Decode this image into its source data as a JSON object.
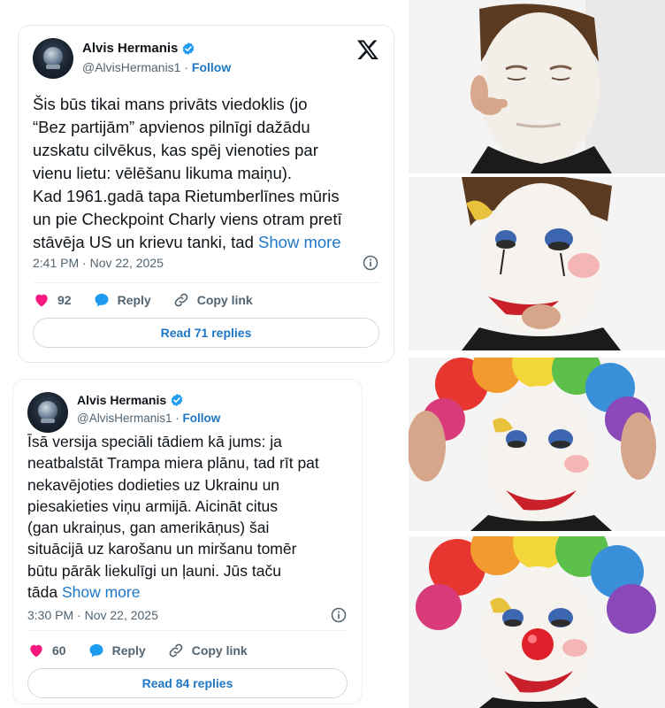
{
  "tweets": [
    {
      "author": "Alvis Hermanis",
      "handle": "@AlvisHermanis1",
      "separator": "·",
      "follow_label": "Follow",
      "text": "Šis būs tikai mans privāts viedoklis (jo\n“Bez partijām” apvienos pilnīgi dažādu\nuzskatu cilvēkus, kas spēj vienoties par\nvienu lietu: vēlēšanu likuma maiņu).\nKad 1961.gadā tapa Rietumberlīnes mūris\nun pie Checkpoint Charly viens otram pretī\nstāvēja US un krievu tanki, tad ",
      "show_more": "Show more",
      "timestamp": "2:41 PM · Nov 22, 2025",
      "likes": "92",
      "reply_label": "Reply",
      "copy_link_label": "Copy link",
      "read_replies": "Read 71 replies"
    },
    {
      "author": "Alvis Hermanis",
      "handle": "@AlvisHermanis1",
      "separator": "·",
      "follow_label": "Follow",
      "text": "Īsā versija speciāli tādiem kā jums: ja\nneatbalstāt Trampa miera plānu, tad rīt pat\nnekavējoties dodieties uz Ukrainu un\npiesakieties viņu armijā.  Aicināt citus\n(gan ukraiņus, gan amerikāņus) šai\nsituācijā uz karošanu un miršanu tomēr\nbūtu pārāk liekulīgi un ļauni. Jūs taču\ntāda ",
      "show_more": "Show more",
      "timestamp": "3:30 PM · Nov 22, 2025",
      "likes": "60",
      "reply_label": "Reply",
      "copy_link_label": "Copy link",
      "read_replies": "Read 84 replies"
    }
  ],
  "colors": {
    "accent": "#1d77c6",
    "verified": "#1d9bf0",
    "like": "#f91880",
    "muted": "#536471"
  },
  "icons": [
    "verified-badge-icon",
    "x-logo-icon",
    "heart-icon",
    "reply-bubble-icon",
    "link-icon",
    "info-icon"
  ],
  "meme_panels": [
    {
      "stage": "white-face-paint"
    },
    {
      "stage": "eyes-and-lips"
    },
    {
      "stage": "rainbow-wig"
    },
    {
      "stage": "red-nose"
    }
  ]
}
